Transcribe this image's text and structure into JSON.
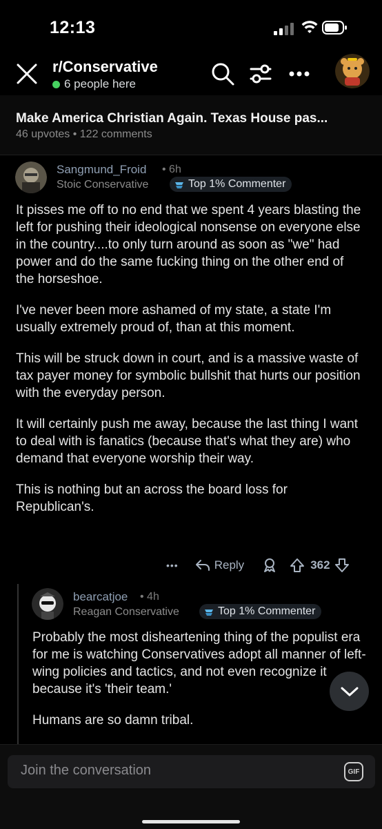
{
  "status": {
    "time": "12:13"
  },
  "header": {
    "subreddit": "r/Conservative",
    "online_text": "6 people here",
    "icons": [
      "close-icon",
      "search-icon",
      "filter-icon",
      "more-icon",
      "avatar"
    ]
  },
  "post": {
    "title": "Make America Christian Again. Texas House pas...",
    "meta": "46 upvotes • 122 comments"
  },
  "comments": [
    {
      "author": "Sangmund_Froid",
      "age": "• 6h",
      "flair": "Stoic Conservative",
      "badge": "Top 1% Commenter",
      "paragraphs": [
        "It pisses me off to no end that we spent 4 years blasting the left for pushing their ideological nonsense on everyone else in the country....to only turn around as soon as \"we\" had power and do the same fucking thing on the other end of the horseshoe.",
        "I've never been more ashamed of my state, a state I'm usually extremely proud of, than at this moment.",
        "This will be struck down in court, and is a massive waste of tax payer money for symbolic bullshit that hurts our position with the everyday person.",
        "It will certainly push me away, because the last thing I want to deal with is fanatics (because that's what they are) who demand that everyone worship their way.",
        "This is nothing but an across the board loss for Republican's."
      ],
      "actions": {
        "more": "•••",
        "reply": "Reply",
        "score": "362"
      }
    },
    {
      "author": "bearcatjoe",
      "age": "• 4h",
      "flair": "Reagan Conservative",
      "badge": "Top 1% Commenter",
      "paragraphs": [
        "Probably the most disheartening thing of the populist era for me is watching Conservatives adopt all manner of left-wing policies and tactics, and not even recognize it because it's 'their team.'",
        "Humans are so damn tribal."
      ]
    }
  ],
  "composer": {
    "placeholder": "Join the conversation",
    "gif_label": "GIF"
  },
  "colors": {
    "online": "#46d160",
    "author": "#8f9fb3",
    "background": "#000000"
  }
}
